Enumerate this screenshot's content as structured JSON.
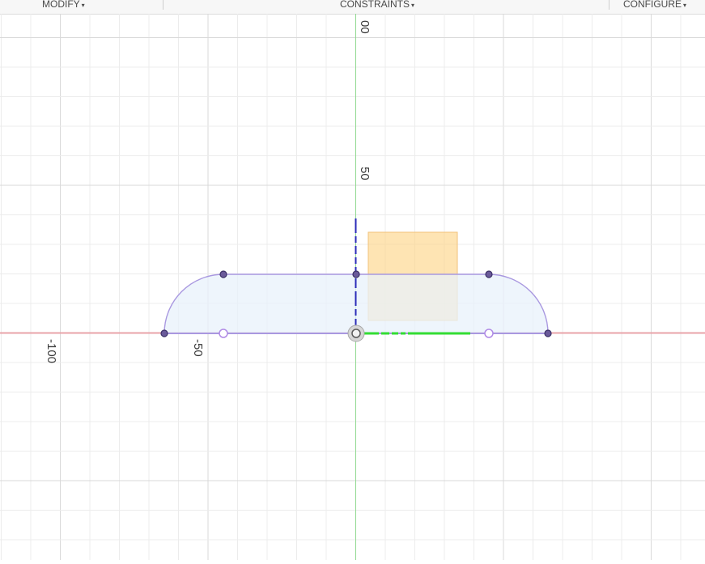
{
  "toolbar": {
    "modify": "MODIFY",
    "constraints": "CONSTRAINTS",
    "configure": "CONFIGURE",
    "caret": "▾"
  },
  "axis_labels": {
    "y_top": "00",
    "y_50": "50",
    "x_neg100": "-100",
    "x_neg50": "-50"
  },
  "colors": {
    "grid_minor": "#ececec",
    "grid_major": "#d9d9d9",
    "x_axis": "#e8a3a9",
    "y_axis": "#8fd88f",
    "profile_stroke": "#a998e0",
    "profile_fill": "#e8f2fb",
    "constraint_blue": "#2a2ab8",
    "horizontal_constraint": "#33dd33",
    "highlight_box": "#fdd58a"
  }
}
